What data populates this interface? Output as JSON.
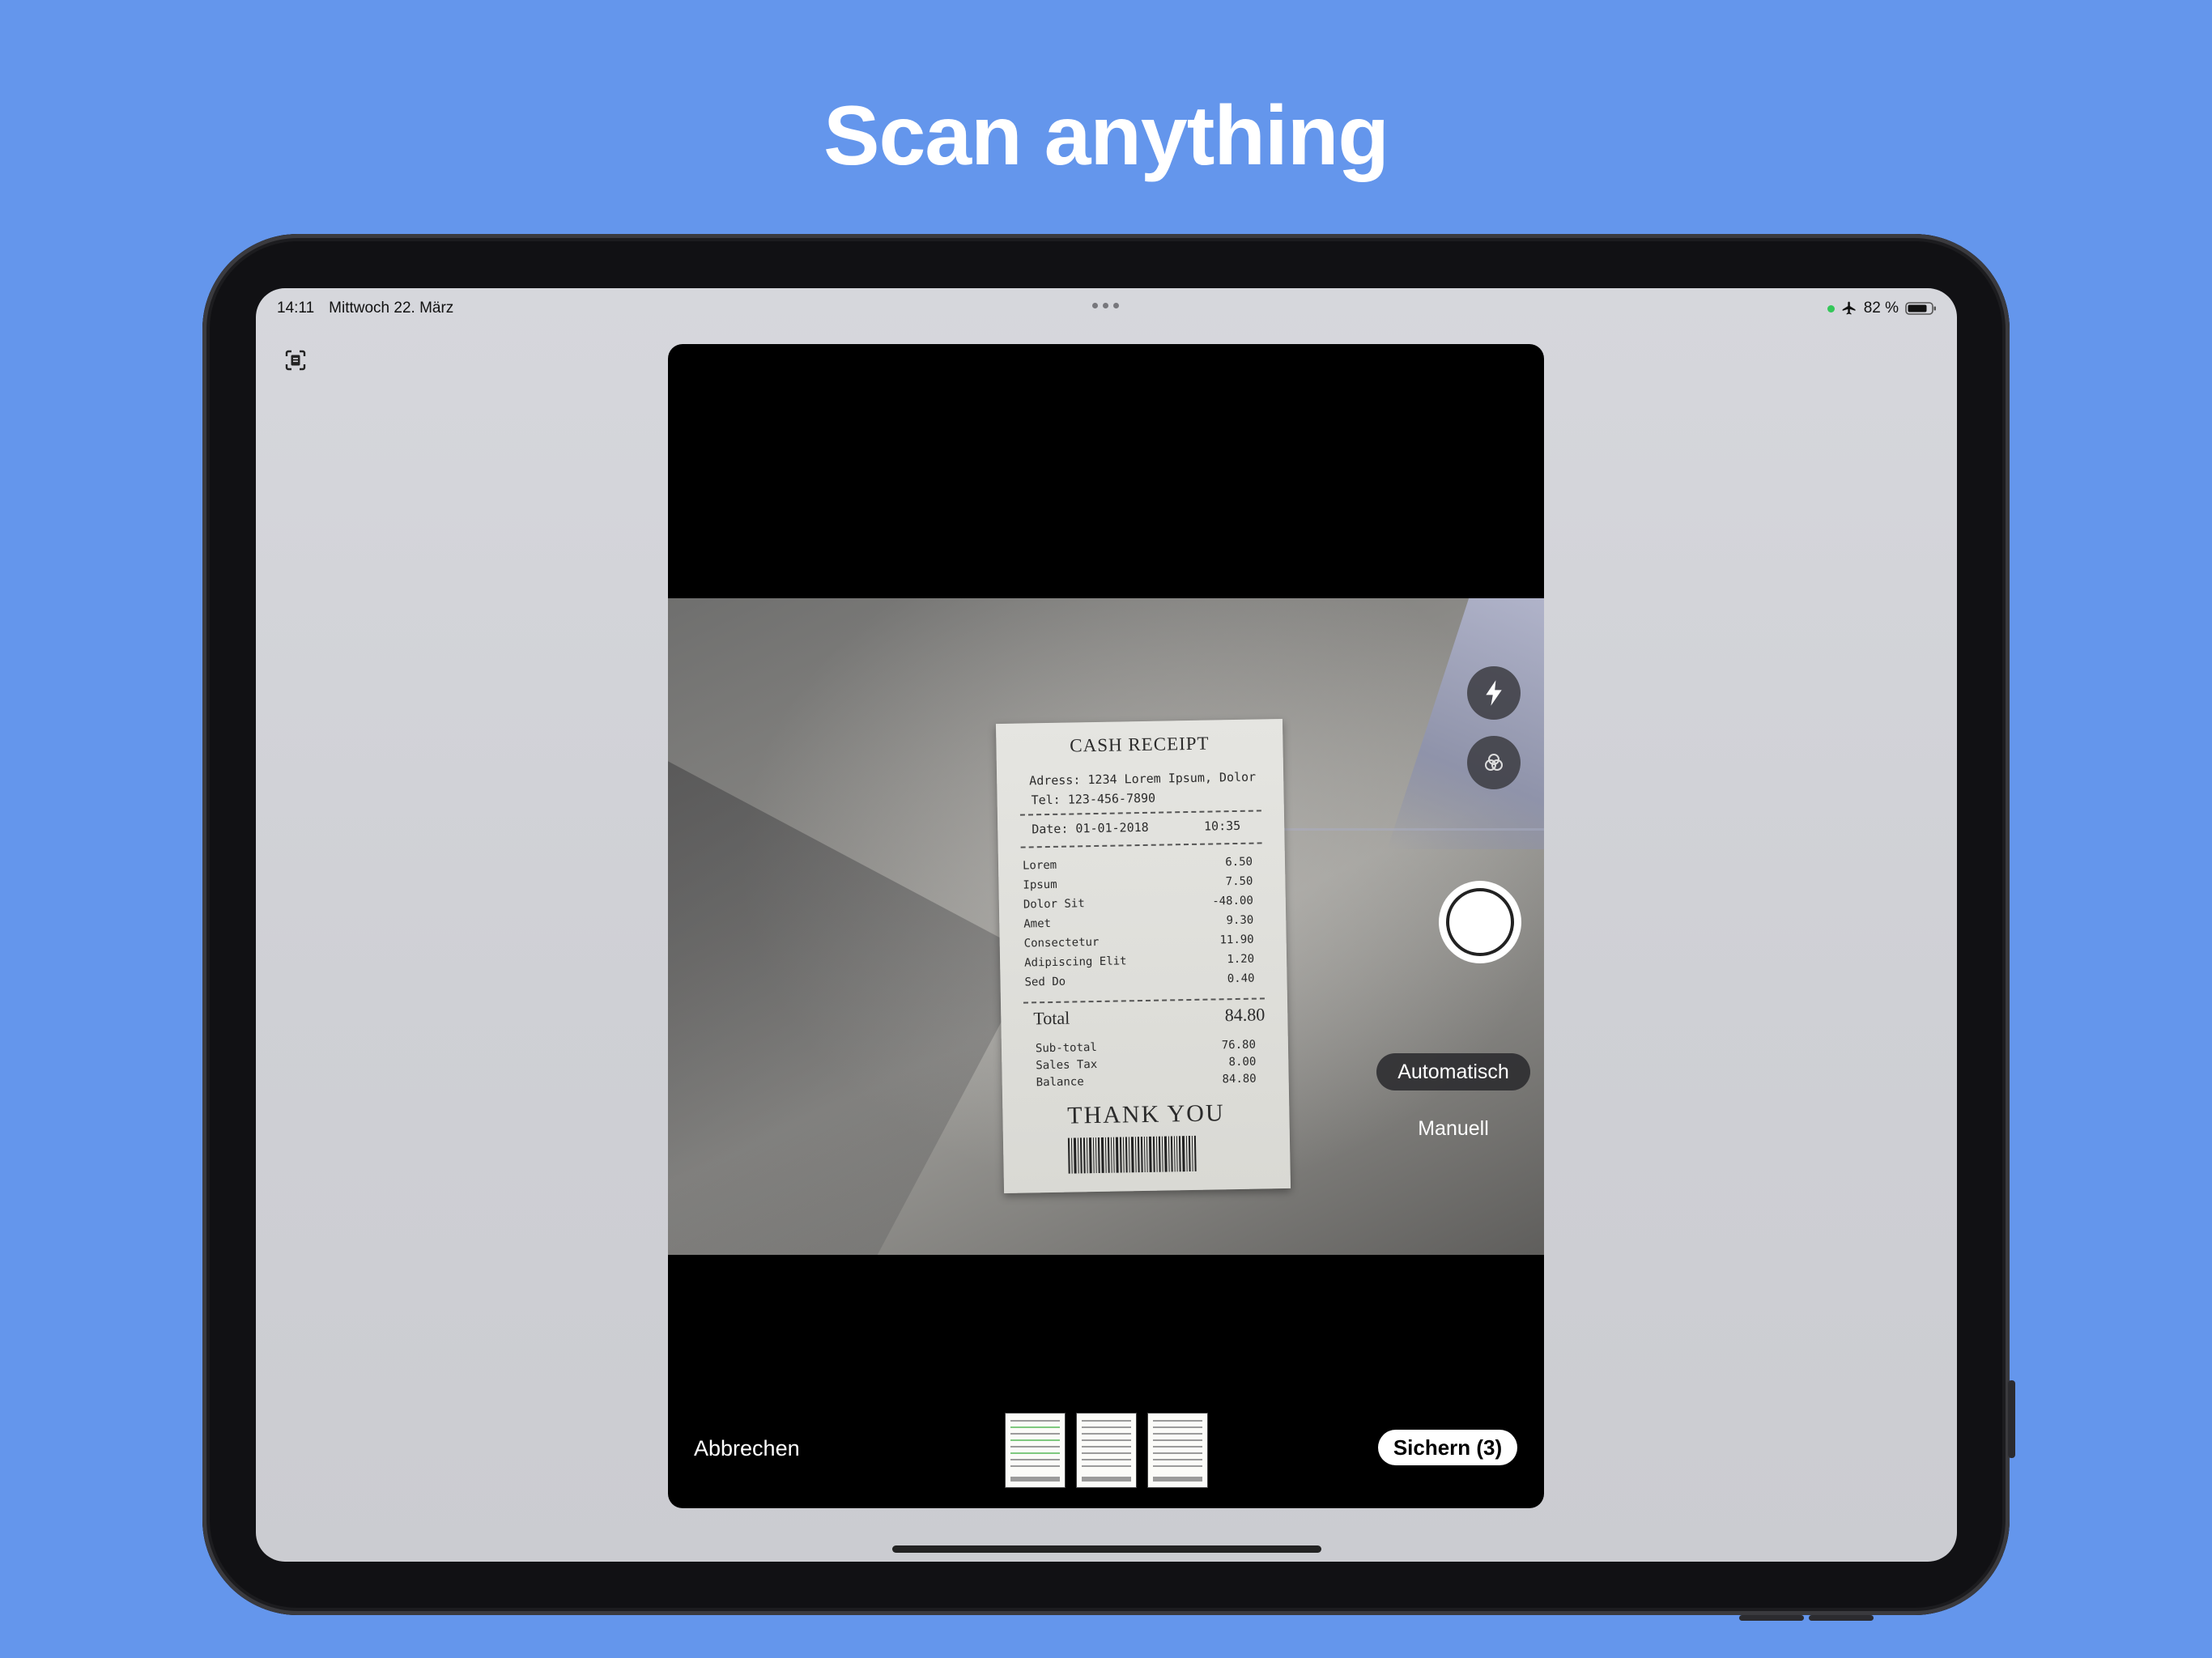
{
  "headline": "Scan anything",
  "status_bar": {
    "time": "14:11",
    "date": "Mittwoch 22. März",
    "battery_percent": "82 %",
    "battery_level": 0.82,
    "airplane_mode_icon": "airplane-icon",
    "camera_in_use_indicator_color": "#34c759"
  },
  "receipt": {
    "title": "CASH RECEIPT",
    "address": "Adress: 1234 Lorem Ipsum, Dolor",
    "tel": "Tel: 123-456-7890",
    "date": "Date: 01-01-2018",
    "time": "10:35",
    "items": [
      {
        "name": "Lorem",
        "price": "6.50"
      },
      {
        "name": "Ipsum",
        "price": "7.50"
      },
      {
        "name": "Dolor Sit",
        "price": "-48.00"
      },
      {
        "name": "Amet",
        "price": "9.30"
      },
      {
        "name": "Consectetur",
        "price": "11.90"
      },
      {
        "name": "Adipiscing Elit",
        "price": "1.20"
      },
      {
        "name": "Sed Do",
        "price": "0.40"
      }
    ],
    "total_label": "Total",
    "total_value": "84.80",
    "subtotals": [
      {
        "name": "Sub-total",
        "value": "76.80"
      },
      {
        "name": "Sales Tax",
        "value": "8.00"
      },
      {
        "name": "Balance",
        "value": "84.80"
      }
    ],
    "thank_you": "THANK YOU"
  },
  "camera": {
    "flash_icon": "flash-icon",
    "filter_icon": "filter-icon",
    "mode_auto": "Automatisch",
    "mode_manual": "Manuell"
  },
  "bottom_bar": {
    "cancel_label": "Abbrechen",
    "save_label": "Sichern (3)",
    "thumbnail_count": 3
  },
  "colors": {
    "background": "#6496ec",
    "headline_text": "#ffffff"
  }
}
